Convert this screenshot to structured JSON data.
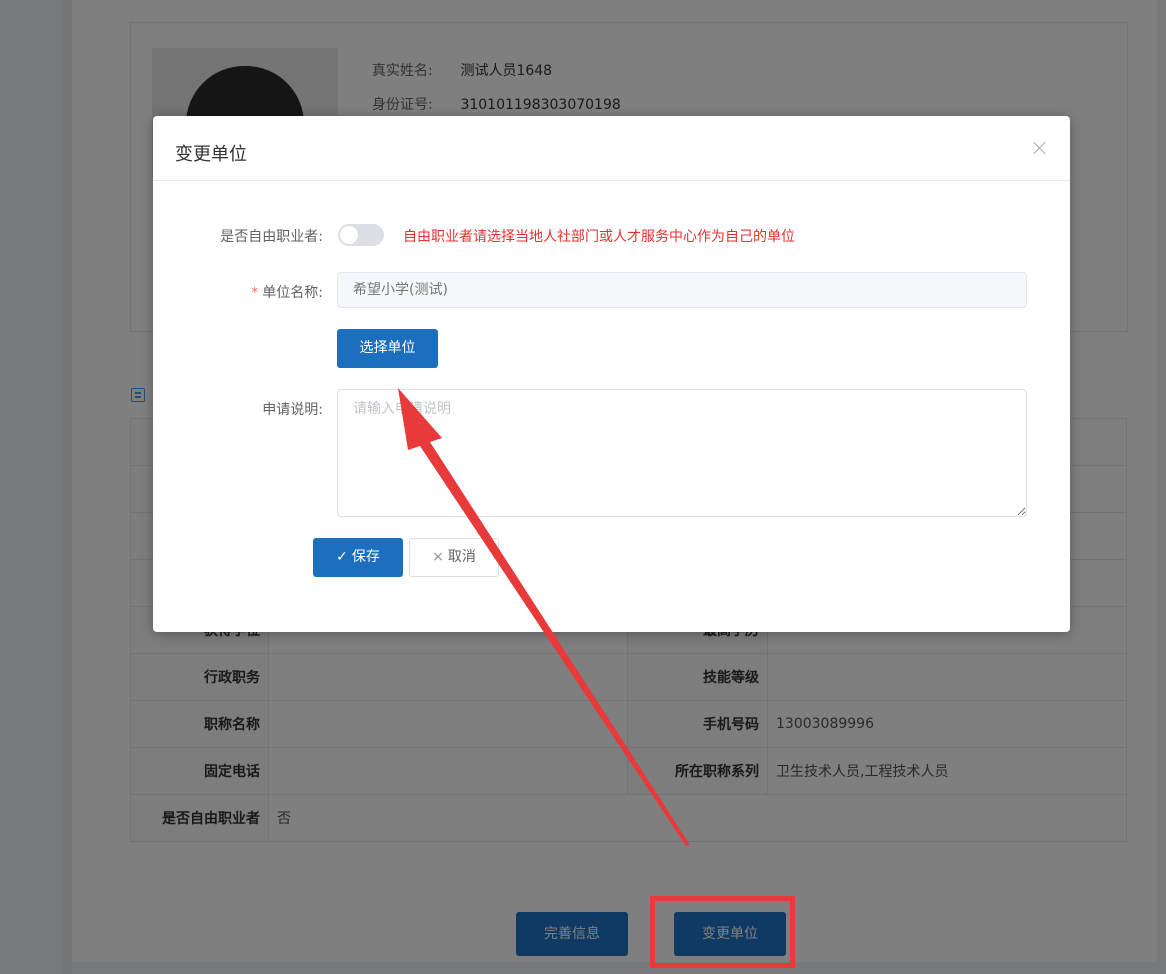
{
  "profile": {
    "name_label": "真实姓名:",
    "name_value": "测试人员1648",
    "id_label": "身份证号:",
    "id_value": "310101198303070198"
  },
  "detail_table": {
    "rows": [
      {
        "k1": "获得学位",
        "v1": "",
        "k2": "最高学历",
        "v2": ""
      },
      {
        "k1": "行政职务",
        "v1": "",
        "k2": "技能等级",
        "v2": ""
      },
      {
        "k1": "职称名称",
        "v1": "",
        "k2": "手机号码",
        "v2": "13003089996"
      },
      {
        "k1": "固定电话",
        "v1": "",
        "k2": "所在职称系列",
        "v2": "卫生技术人员,工程技术人员"
      },
      {
        "k1": "是否自由职业者",
        "v1": "否",
        "k2": "",
        "v2": ""
      }
    ]
  },
  "bottom_actions": {
    "complete_info": "完善信息",
    "change_unit": "变更单位"
  },
  "dialog": {
    "title": "变更单位",
    "freelancer_label": "是否自由职业者:",
    "freelancer_on": false,
    "freelancer_hint": "自由职业者请选择当地人社部门或人才服务中心作为自己的单位",
    "unit_required_mark": "*",
    "unit_label": "单位名称:",
    "unit_placeholder": "希望小学(测试)",
    "select_unit_button": "选择单位",
    "remark_label": "申请说明:",
    "remark_placeholder": "请输入申请说明",
    "save_button": "保存",
    "cancel_button": "取消"
  },
  "colors": {
    "primary": "#1c6fbf",
    "hint_red": "#e8302f",
    "annotation_red": "#e83a3a"
  }
}
